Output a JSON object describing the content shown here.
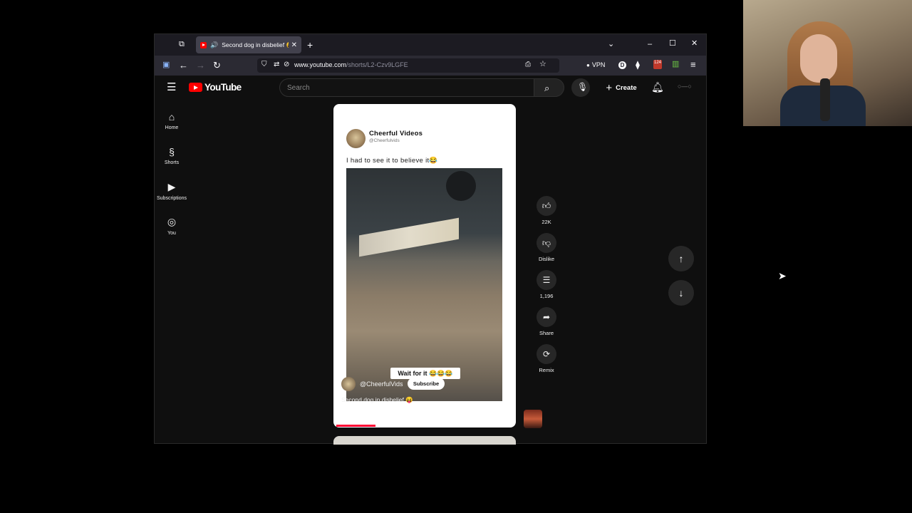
{
  "browser": {
    "tab_title": "Second dog in disbelief 😝",
    "url_host": "www.youtube.com",
    "url_path": "/shorts/L2-Czv9LGFE",
    "vpn_label": "VPN",
    "ext_badge": "124"
  },
  "youtube": {
    "logo_text": "YouTube",
    "search_placeholder": "Search",
    "create_label": "Create",
    "sidebar": [
      {
        "label": "Home",
        "icon": "home-icon"
      },
      {
        "label": "Shorts",
        "icon": "shorts-icon"
      },
      {
        "label": "Subscriptions",
        "icon": "subscriptions-icon"
      },
      {
        "label": "You",
        "icon": "user-icon"
      }
    ],
    "short": {
      "post_author": "Cheerful Videos",
      "post_handle": "@Cheerfulvids",
      "post_caption": "I had to see it to believe it😂",
      "overlay_text": "Wait for it 😂😂😂",
      "channel": "@CheerfulVids",
      "subscribe_label": "Subscribe",
      "title": "Second dog in disbelief 😝",
      "progress": 0.22
    },
    "actions": {
      "like_count": "22K",
      "dislike_label": "Dislike",
      "comment_count": "1,196",
      "share_label": "Share",
      "remix_label": "Remix"
    }
  }
}
